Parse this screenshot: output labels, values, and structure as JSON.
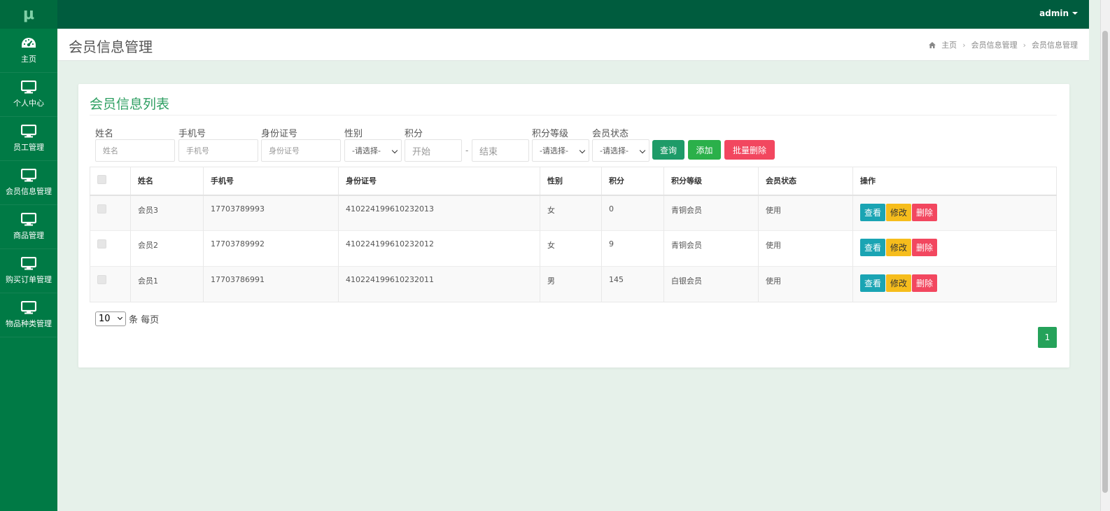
{
  "sidebar": {
    "logo": "μ",
    "items": [
      {
        "label": "主页",
        "icon": "dashboard-icon"
      },
      {
        "label": "个人中心",
        "icon": "monitor-icon"
      },
      {
        "label": "员工管理",
        "icon": "monitor-icon"
      },
      {
        "label": "会员信息管理",
        "icon": "monitor-icon"
      },
      {
        "label": "商品管理",
        "icon": "monitor-icon"
      },
      {
        "label": "购买订单管理",
        "icon": "monitor-icon"
      },
      {
        "label": "物品种类管理",
        "icon": "monitor-icon"
      }
    ]
  },
  "topbar": {
    "user": "admin"
  },
  "header": {
    "title": "会员信息管理",
    "breadcrumb": [
      "主页",
      "会员信息管理",
      "会员信息管理"
    ]
  },
  "card": {
    "title": "会员信息列表"
  },
  "filters": {
    "name": {
      "label": "姓名",
      "placeholder": "姓名"
    },
    "phone": {
      "label": "手机号",
      "placeholder": "手机号"
    },
    "idcard": {
      "label": "身份证号",
      "placeholder": "身份证号"
    },
    "gender": {
      "label": "性别",
      "value": "-请选择-"
    },
    "points": {
      "label": "积分",
      "start_placeholder": "开始",
      "end_placeholder": "结束",
      "dash": "-"
    },
    "level": {
      "label": "积分等级",
      "value": "-请选择-"
    },
    "status": {
      "label": "会员状态",
      "value": "-请选择-"
    },
    "buttons": {
      "query": "查询",
      "add": "添加",
      "batch_delete": "批量删除"
    }
  },
  "table": {
    "headers": [
      "姓名",
      "手机号",
      "身份证号",
      "性别",
      "积分",
      "积分等级",
      "会员状态",
      "操作"
    ],
    "rows": [
      {
        "name": "会员3",
        "phone": "17703789993",
        "idcard": "410224199610232013",
        "gender": "女",
        "points": "0",
        "level": "青铜会员",
        "status": "使用"
      },
      {
        "name": "会员2",
        "phone": "17703789992",
        "idcard": "410224199610232012",
        "gender": "女",
        "points": "9",
        "level": "青铜会员",
        "status": "使用"
      },
      {
        "name": "会员1",
        "phone": "17703786991",
        "idcard": "410224199610232011",
        "gender": "男",
        "points": "145",
        "level": "白银会员",
        "status": "使用"
      }
    ],
    "actions": {
      "view": "查看",
      "edit": "修改",
      "delete": "删除"
    }
  },
  "pagination": {
    "page_size": "10",
    "per_page_text": "条 每页",
    "current_page": "1"
  },
  "colors": {
    "sidebar": "#007a45",
    "topbar": "#005c3e",
    "accent": "#2e9f62",
    "query": "#1e9b68",
    "add": "#2bb04a",
    "danger": "#f2475f",
    "view": "#1aa4b3",
    "edit": "#f6bd1c"
  }
}
